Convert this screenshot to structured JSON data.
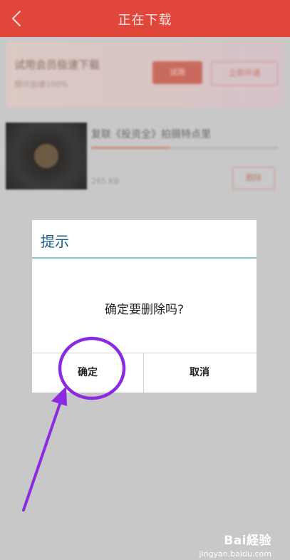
{
  "header": {
    "title": "正在下载",
    "back_icon": "chevron-left-icon",
    "color": "#e0463a"
  },
  "background": {
    "promo": {
      "title": "试用会员极速下载",
      "subtitle": "预计加速100%",
      "button_primary": "试用",
      "button_secondary": "立即开通"
    },
    "download_item": {
      "name": "复联《投资全》拍摄特点里",
      "size": "265 KB",
      "button": "删除",
      "progress": 0.42
    }
  },
  "dialog": {
    "title": "提示",
    "message": "确定要删除吗?",
    "confirm_label": "确定",
    "cancel_label": "取消",
    "title_color": "#1a5a88",
    "divider_color": "#8ec3d4"
  },
  "annotation": {
    "color": "#8a2be2",
    "shapes": [
      "circle-highlight",
      "arrow"
    ]
  },
  "watermark": {
    "logo": "Bai経验",
    "url": "jingyan.baidu.com"
  }
}
